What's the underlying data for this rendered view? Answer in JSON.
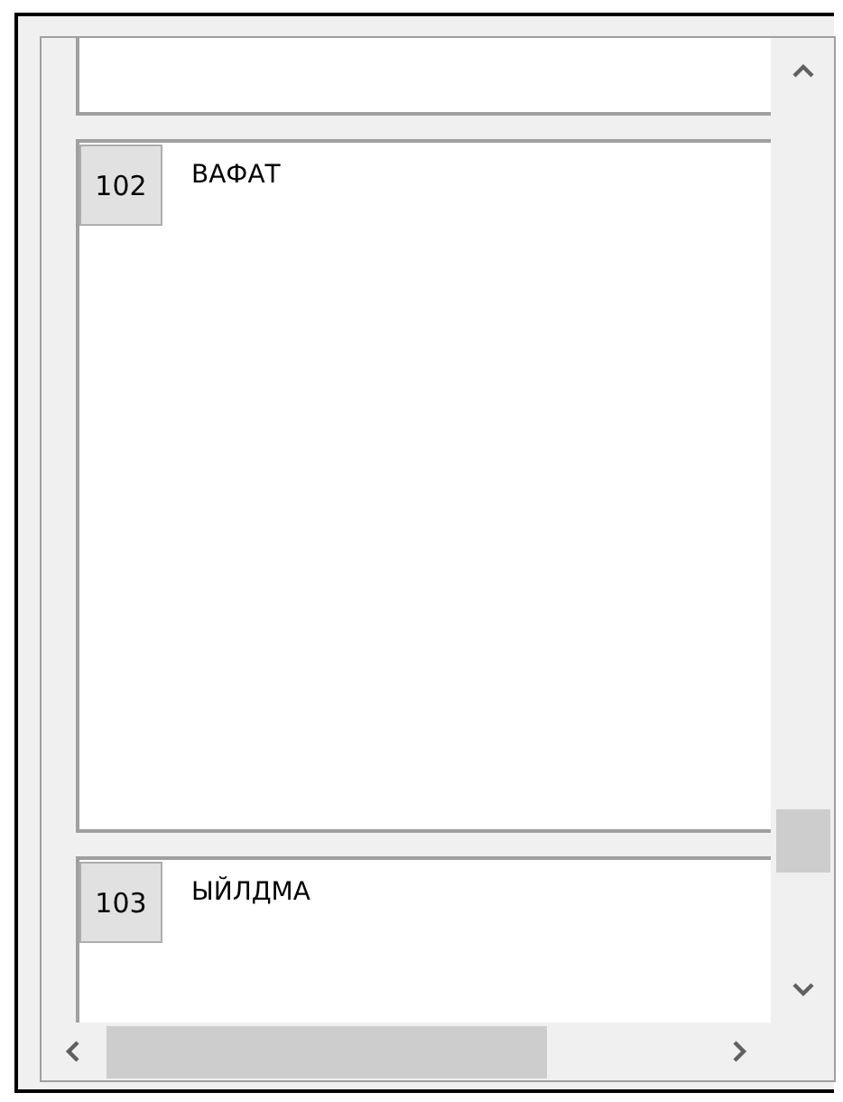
{
  "records": [
    {
      "number": "102",
      "text": "ВАФАТ"
    },
    {
      "number": "103",
      "text": "ЫЙЛДМА"
    }
  ]
}
